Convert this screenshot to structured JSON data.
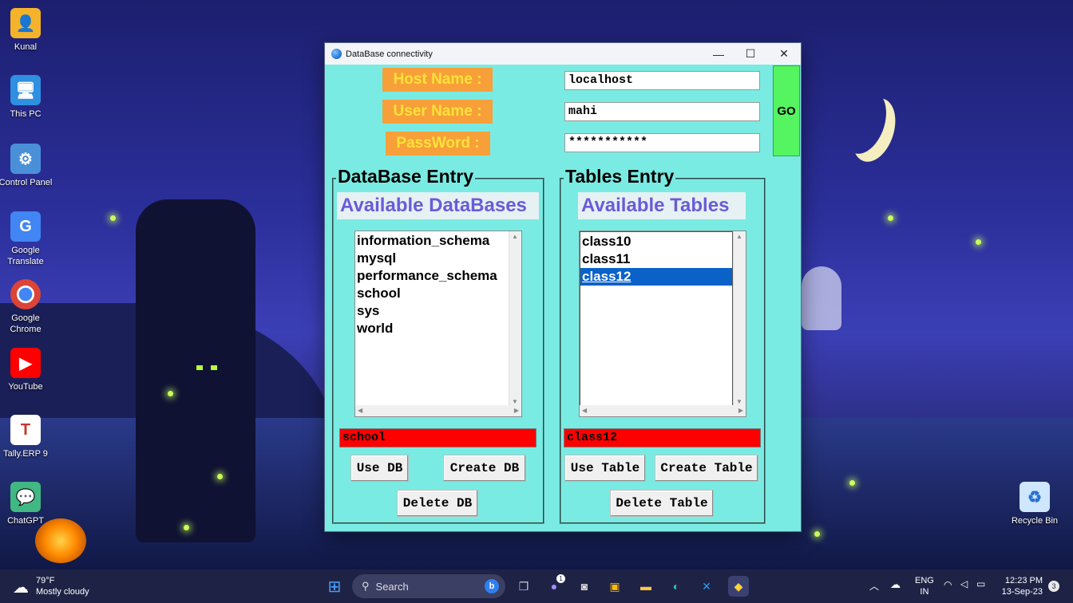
{
  "desktop": {
    "icons": [
      {
        "label": "Kunal",
        "glyph": "👤",
        "color": "#f4b32a"
      },
      {
        "label": "This PC",
        "glyph": "🖥",
        "color": "#3aa6ff"
      },
      {
        "label": "Control Panel",
        "glyph": "⚙",
        "color": "#4a90d9"
      },
      {
        "label": "Google Translate",
        "glyph": "G",
        "color": "#4285f4"
      },
      {
        "label": "Google Chrome",
        "glyph": "◉",
        "color": "#ffffff"
      },
      {
        "label": "YouTube",
        "glyph": "▶",
        "color": "#ff0000"
      },
      {
        "label": "Tally.ERP 9",
        "glyph": "T",
        "color": "#ffffff"
      },
      {
        "label": "ChatGPT",
        "glyph": "💬",
        "color": "#41b883"
      },
      {
        "label": "Recycle Bin",
        "glyph": "♻",
        "color": "#cfe6ff"
      }
    ]
  },
  "window": {
    "title": "DataBase connectivity",
    "controls": {
      "minimize": "—",
      "maximize": "☐",
      "close": "✕"
    }
  },
  "login": {
    "host_label": "Host Name :",
    "user_label": "User Name :",
    "password_label": "PassWord :",
    "host_value": "localhost",
    "user_value": "mahi",
    "password_value": "***********",
    "go_label": "GO"
  },
  "db_frame": {
    "title": "DataBase Entry",
    "subtitle": "Available DataBases",
    "items": [
      "information_schema",
      "mysql",
      "performance_schema",
      "school",
      "sys",
      "world"
    ],
    "selected_value": "school",
    "buttons": {
      "use": "Use DB",
      "create": "Create DB",
      "delete": "Delete DB"
    }
  },
  "table_frame": {
    "title": "Tables Entry",
    "subtitle": "Available Tables",
    "items": [
      "class10",
      "class11",
      "class12"
    ],
    "selected_index": 2,
    "selected_value": "class12",
    "buttons": {
      "use": "Use Table",
      "create": "Create Table",
      "delete": "Delete Table"
    }
  },
  "taskbar": {
    "weather_temp": "79°F",
    "weather_desc": "Mostly cloudy",
    "search_placeholder": "Search",
    "lang_top": "ENG",
    "lang_bottom": "IN",
    "time": "12:23 PM",
    "date": "13-Sep-23",
    "notification_count": "3",
    "chat_badge": "1"
  },
  "colors": {
    "window_bg": "#7aebe3",
    "label_bg": "#f7a03a",
    "label_text": "#ffe238",
    "go_bg": "#54f560",
    "selected_entry_bg": "#ff0000",
    "subtitle_text": "#6a5bd8",
    "list_selection": "#0a62c9"
  }
}
